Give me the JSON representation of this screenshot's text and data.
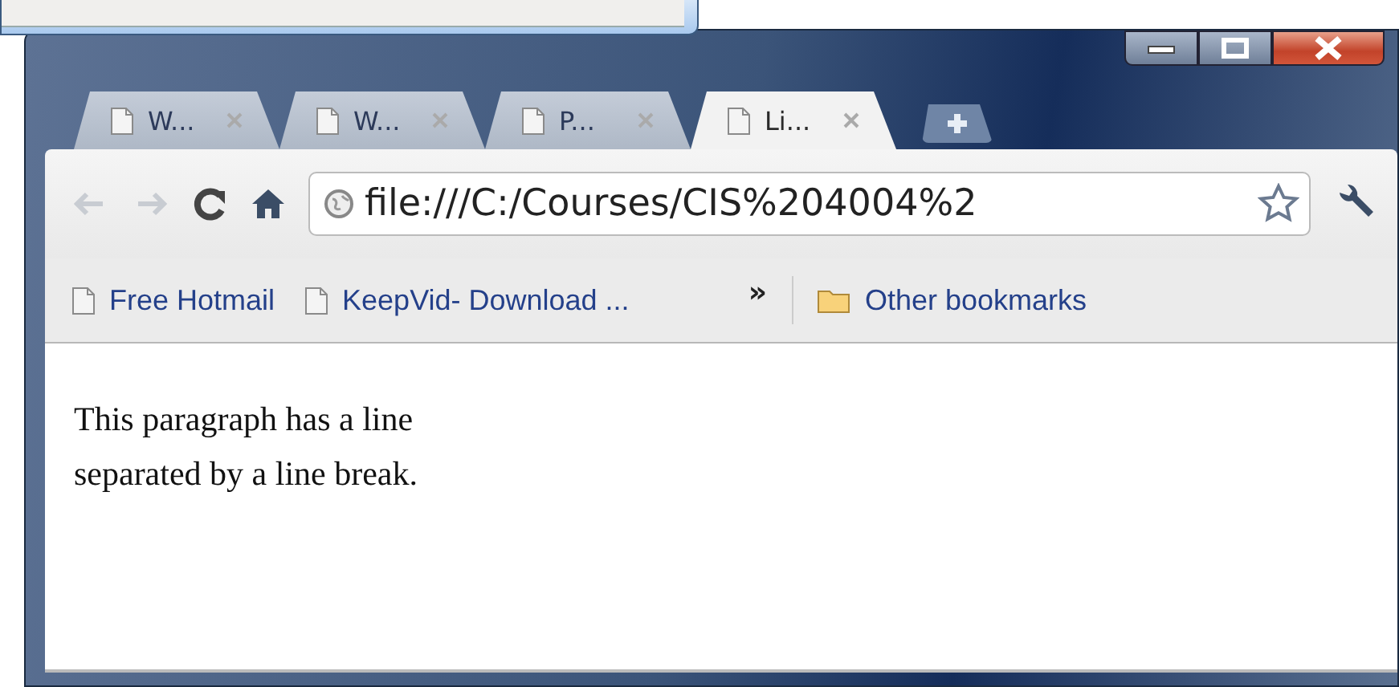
{
  "tabs": [
    {
      "title": "W...",
      "selected": false
    },
    {
      "title": "W...",
      "selected": false
    },
    {
      "title": "P...",
      "selected": false
    },
    {
      "title": "Li...",
      "selected": true
    }
  ],
  "toolbar": {
    "back_disabled": true,
    "forward_disabled": true,
    "address": "file:///C:/Courses/CIS%204004%2"
  },
  "bookmarks": [
    {
      "label": "Free Hotmail",
      "kind": "page"
    },
    {
      "label": "KeepVid- Download ...",
      "kind": "page"
    },
    {
      "label": "Other bookmarks",
      "kind": "folder"
    }
  ],
  "bookmarks_overflow": "»",
  "content": {
    "paragraph": "This paragraph has a line\nseparated by a line break."
  }
}
